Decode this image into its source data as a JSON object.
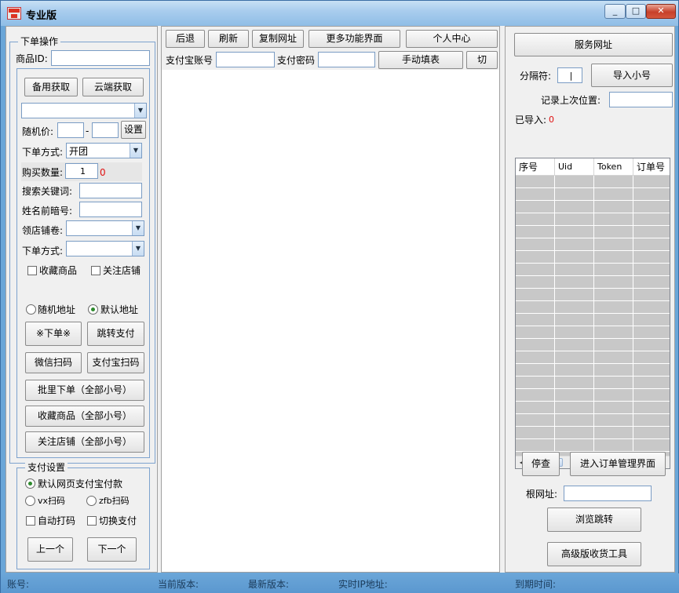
{
  "window": {
    "title": "专业版",
    "minimize": "_",
    "maximize": "□",
    "close": "✕"
  },
  "order": {
    "group_title": "下单操作",
    "product_id_label": "商品ID:",
    "backup_fetch": "备用获取",
    "cloud_fetch": "云端获取",
    "random_price_label": "随机价:",
    "price_dash": "-",
    "set_button": "设置",
    "order_mode_label": "下单方式:",
    "order_mode_value": "开团",
    "buy_qty_label": "购买数量:",
    "buy_qty_value": "1",
    "buy_qty_count": "0",
    "search_keyword_label": "搜索关键词:",
    "name_code_label": "姓名前暗号:",
    "shop_coupon_label": "领店铺卷:",
    "order_mode2_label": "下单方式:",
    "fav_product": "收藏商品",
    "follow_shop": "关注店铺",
    "random_address": "随机地址",
    "default_address": "默认地址",
    "place_order": "※下单※",
    "goto_pay": "跳转支付",
    "wechat_scan": "微信扫码",
    "alipay_scan": "支付宝扫码",
    "batch_order": "批里下单（全部小号）",
    "batch_fav": "收藏商品（全部小号）",
    "batch_follow": "关注店铺（全部小号）"
  },
  "pay": {
    "group_title": "支付设置",
    "default_alipay": "默认网页支付宝付款",
    "vx_scan": "vx扫码",
    "zfb_scan": "zfb扫码",
    "auto_code": "自动打码",
    "switch_pay": "切换支付",
    "prev": "上一个",
    "next": "下一个"
  },
  "toolbar": {
    "back": "后退",
    "refresh": "刷新",
    "copy_url": "复制网址",
    "more_features": "更多功能界面",
    "personal_center": "个人中心",
    "alipay_account_label": "支付宝账号",
    "alipay_password_label": "支付密码",
    "manual_fill": "手动填表",
    "switch": "切"
  },
  "right": {
    "service_url": "服务网址",
    "separator_label": "分隔符:",
    "separator_value": "|",
    "import_accounts": "导入小号",
    "remember_pos_label": "记录上次位置:",
    "imported_label": "已导入:",
    "imported_count": "0",
    "columns": [
      "序号",
      "Uid",
      "Token",
      "订单号"
    ],
    "stop_check": "停查",
    "order_mgmt": "进入订单管理界面",
    "root_url_label": "根网址:",
    "browse_jump": "浏览跳转",
    "advanced_tool": "高级版收货工具"
  },
  "statusbar": {
    "account": "账号:",
    "current_version": "当前版本:",
    "latest_version": "最新版本:",
    "realtime_ip": "实时IP地址:",
    "expire_time": "到期时间:"
  }
}
